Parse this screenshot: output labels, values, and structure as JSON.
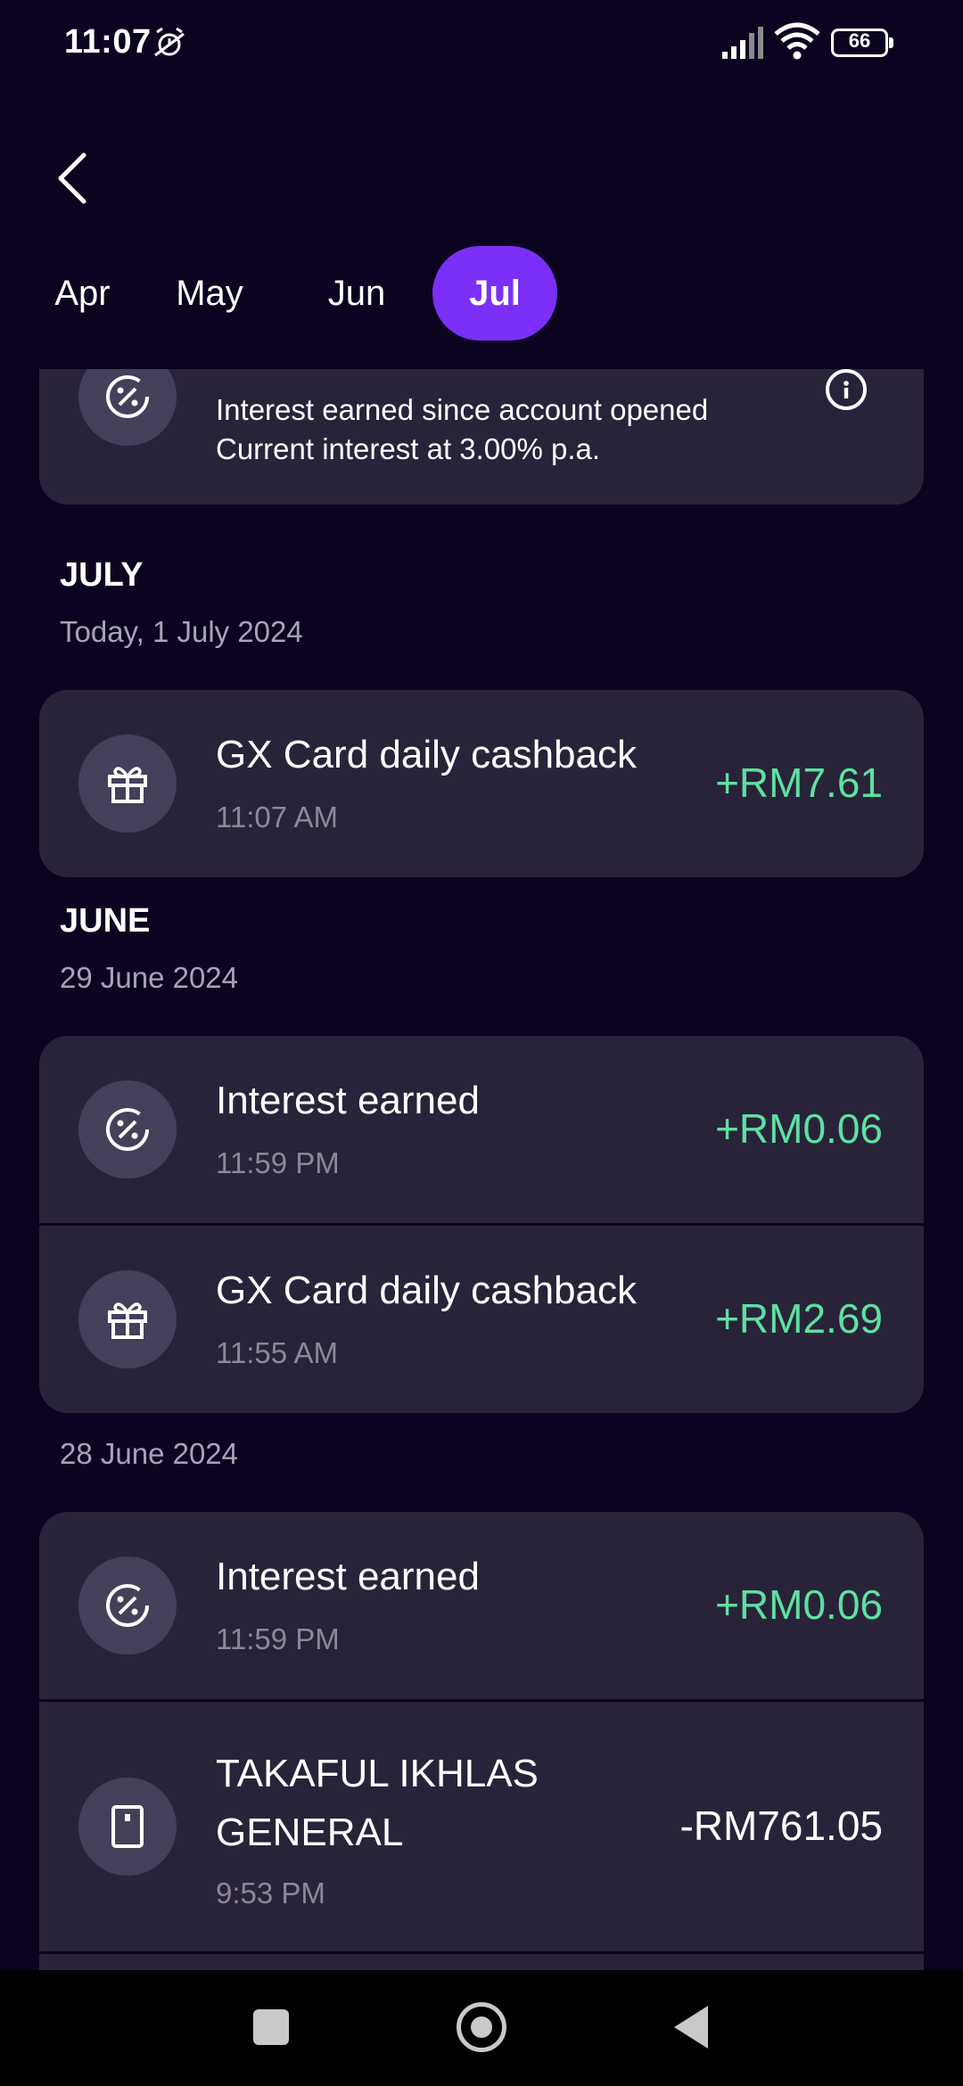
{
  "status_bar": {
    "time": "11:07",
    "battery": "66",
    "icons": [
      "alarm-off-icon",
      "signal-icon",
      "wifi-icon",
      "battery-icon"
    ]
  },
  "header": {
    "back_icon": "chevron-left-icon",
    "tabs": [
      {
        "label": "Apr",
        "selected": false
      },
      {
        "label": "May",
        "selected": false
      },
      {
        "label": "Jun",
        "selected": false
      },
      {
        "label": "Jul",
        "selected": true
      }
    ],
    "accent_color": "#7b2ff7"
  },
  "interest_card": {
    "line1": "Interest earned since account opened",
    "line2": "Current interest at 3.00% p.a."
  },
  "sections": [
    {
      "title": "JULY",
      "groups": [
        {
          "date": "Today, 1 July 2024",
          "transactions": [
            {
              "title": "GX Card daily cashback",
              "time": "11:07 AM",
              "amount": "+RM7.61",
              "icon": "gift-icon"
            }
          ]
        }
      ]
    },
    {
      "title": "JUNE",
      "groups": [
        {
          "date": "29 June 2024",
          "transactions": [
            {
              "title": "Interest earned",
              "time": "11:59 PM",
              "amount": "+RM0.06",
              "icon": "percent-icon"
            },
            {
              "title": "GX Card daily cashback",
              "time": "11:55 AM",
              "amount": "+RM2.69",
              "icon": "gift-icon"
            }
          ]
        },
        {
          "date": "28 June 2024",
          "transactions": [
            {
              "title": "Interest earned",
              "time": "11:59 PM",
              "amount": "+RM0.06",
              "icon": "percent-icon"
            },
            {
              "title": "TAKAFUL IKHLAS GENERAL",
              "time": "9:53 PM",
              "amount": "-RM761.05",
              "icon": "card-icon"
            }
          ]
        }
      ]
    }
  ],
  "colors": {
    "background": "#0b0320",
    "card": "#29233a",
    "positive_amount": "#5ee0a0",
    "secondary_text": "#a8a3b5"
  },
  "nav_bar": {
    "icons": [
      "recents-icon",
      "home-icon",
      "back-icon"
    ]
  }
}
